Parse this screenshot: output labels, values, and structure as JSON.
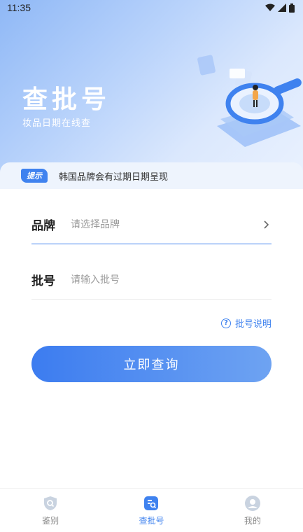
{
  "status_bar": {
    "time": "11:35"
  },
  "hero": {
    "title": "查批号",
    "subtitle": "妆品日期在线查"
  },
  "tip": {
    "badge": "提示",
    "text": "韩国品牌会有过期日期呈现"
  },
  "form": {
    "brand": {
      "label": "品牌",
      "placeholder": "请选择品牌",
      "value": ""
    },
    "batch": {
      "label": "批号",
      "placeholder": "请输入批号",
      "value": ""
    }
  },
  "help_link": {
    "label": "批号说明",
    "icon_text": "?"
  },
  "submit_button": {
    "label": "立即查询"
  },
  "bottom_nav": {
    "items": [
      {
        "label": "鉴别",
        "icon": "shield-search-icon",
        "active": false
      },
      {
        "label": "查批号",
        "icon": "batch-search-icon",
        "active": true
      },
      {
        "label": "我的",
        "icon": "user-icon",
        "active": false
      }
    ]
  },
  "colors": {
    "accent": "#3f82ef",
    "inactive": "#8a8a8a",
    "tip_bg": "#eef4fd"
  }
}
